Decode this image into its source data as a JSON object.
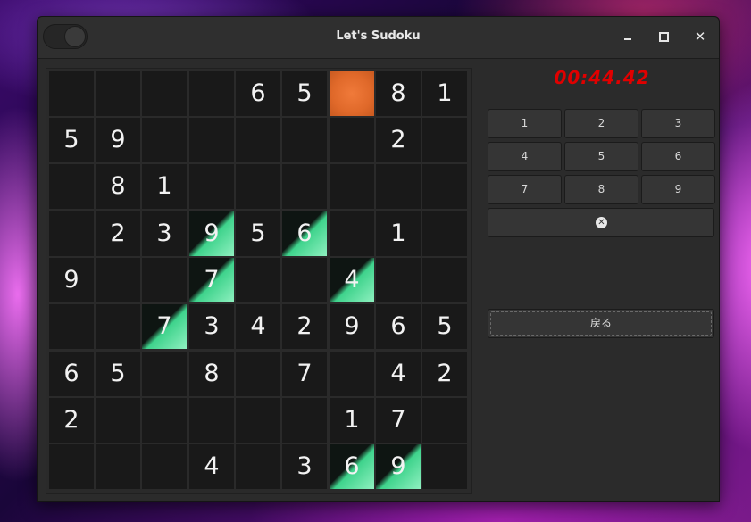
{
  "window": {
    "title": "Let's Sudoku"
  },
  "timer": "00:44.42",
  "board": {
    "rows": [
      [
        "",
        "",
        "",
        "",
        "6",
        "5",
        "",
        "8",
        "1"
      ],
      [
        "5",
        "9",
        "",
        "",
        "",
        "",
        "",
        "2",
        ""
      ],
      [
        "",
        "8",
        "1",
        "",
        "",
        "",
        "",
        "",
        ""
      ],
      [
        "",
        "2",
        "3",
        "9",
        "5",
        "6",
        "",
        "1",
        ""
      ],
      [
        "9",
        "",
        "",
        "7",
        "",
        "",
        "4",
        "",
        ""
      ],
      [
        "",
        "",
        "7",
        "3",
        "4",
        "2",
        "9",
        "6",
        "5"
      ],
      [
        "6",
        "5",
        "",
        "8",
        "",
        "7",
        "",
        "4",
        "2"
      ],
      [
        "2",
        "",
        "",
        "",
        "",
        "",
        "1",
        "7",
        ""
      ],
      [
        "",
        "",
        "",
        "4",
        "",
        "3",
        "6",
        "9",
        ""
      ]
    ],
    "selected": [
      0,
      6
    ],
    "highlighted": [
      [
        3,
        3
      ],
      [
        3,
        5
      ],
      [
        4,
        3
      ],
      [
        4,
        6
      ],
      [
        5,
        2
      ],
      [
        8,
        6
      ],
      [
        8,
        7
      ]
    ],
    "colors": {
      "selected": "#e8722f",
      "highlight": "#5be0a0",
      "cell": "#191919"
    }
  },
  "keypad": {
    "labels": [
      "1",
      "2",
      "3",
      "4",
      "5",
      "6",
      "7",
      "8",
      "9"
    ],
    "erase_icon": "clear-circle-icon"
  },
  "back_label": "戻る"
}
